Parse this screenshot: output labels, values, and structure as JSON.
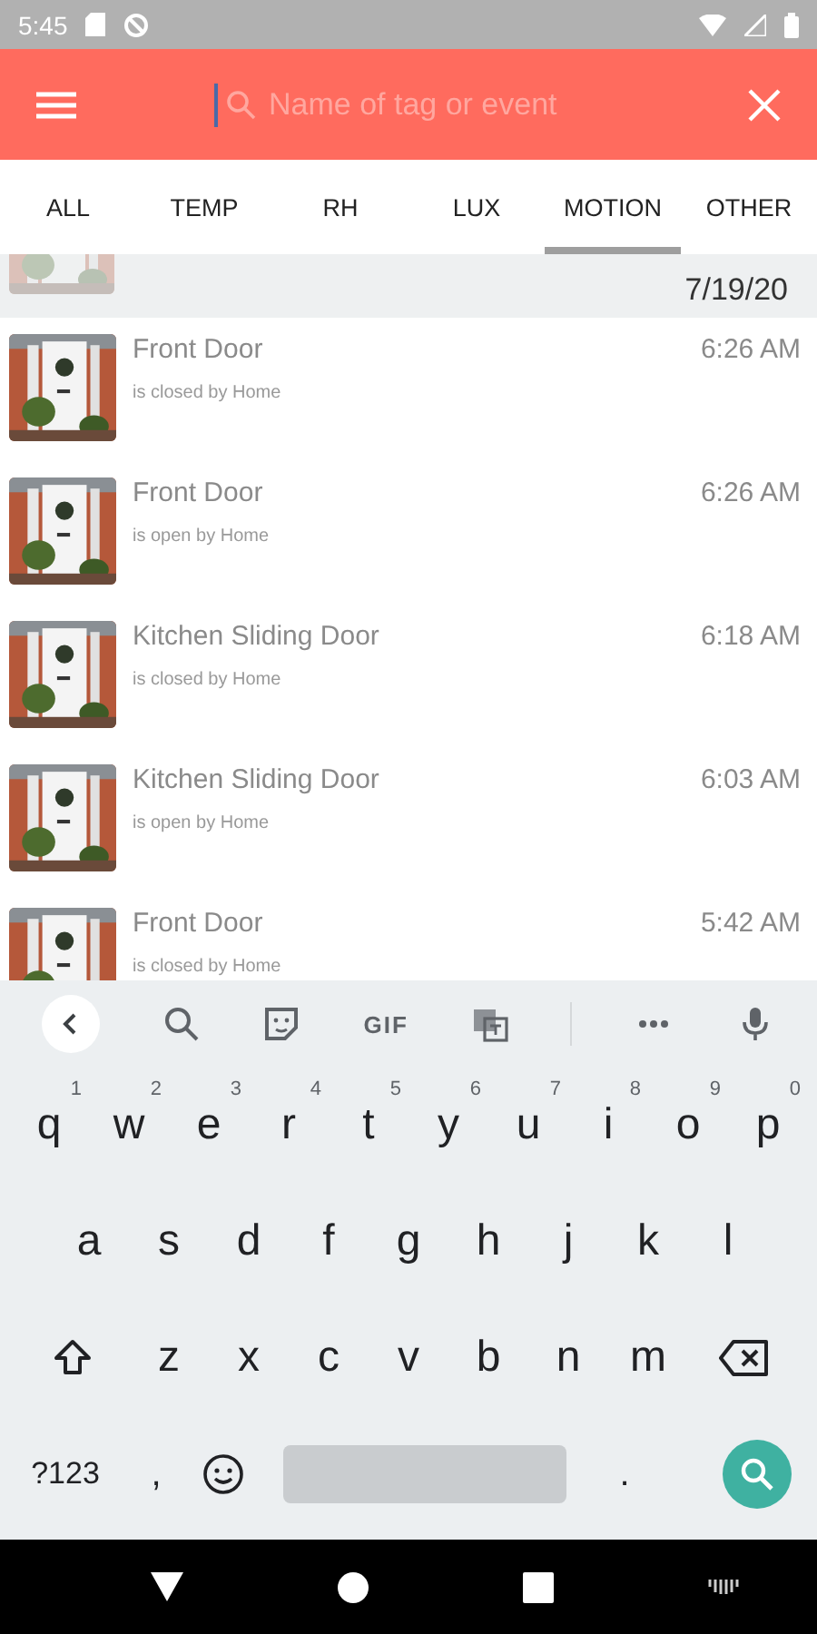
{
  "status_bar": {
    "time": "5:45"
  },
  "app_bar": {
    "search": {
      "placeholder": "Name of tag or event"
    }
  },
  "tabs": [
    {
      "label": "ALL",
      "selected": false
    },
    {
      "label": "TEMP",
      "selected": false
    },
    {
      "label": "RH",
      "selected": false
    },
    {
      "label": "LUX",
      "selected": false
    },
    {
      "label": "MOTION",
      "selected": true
    },
    {
      "label": "OTHER",
      "selected": false
    }
  ],
  "events": {
    "date": "7/19/20",
    "items": [
      {
        "title": "Front Door",
        "detail": "is closed by Home",
        "time": "6:26 AM"
      },
      {
        "title": "Front Door",
        "detail": "is open by Home",
        "time": "6:26 AM"
      },
      {
        "title": "Kitchen Sliding Door",
        "detail": "is closed by Home",
        "time": "6:18 AM"
      },
      {
        "title": "Kitchen Sliding Door",
        "detail": "is open by Home",
        "time": "6:03 AM"
      },
      {
        "title": "Front Door",
        "detail": "is closed by Home",
        "time": "5:42 AM"
      }
    ]
  },
  "keyboard": {
    "toolbar": {
      "gif": "GIF"
    },
    "rows": [
      [
        {
          "label": "q",
          "hint": "1"
        },
        {
          "label": "w",
          "hint": "2"
        },
        {
          "label": "e",
          "hint": "3"
        },
        {
          "label": "r",
          "hint": "4"
        },
        {
          "label": "t",
          "hint": "5"
        },
        {
          "label": "y",
          "hint": "6"
        },
        {
          "label": "u",
          "hint": "7"
        },
        {
          "label": "i",
          "hint": "8"
        },
        {
          "label": "o",
          "hint": "9"
        },
        {
          "label": "p",
          "hint": "0"
        }
      ],
      [
        {
          "label": "a"
        },
        {
          "label": "s"
        },
        {
          "label": "d"
        },
        {
          "label": "f"
        },
        {
          "label": "g"
        },
        {
          "label": "h"
        },
        {
          "label": "j"
        },
        {
          "label": "k"
        },
        {
          "label": "l"
        }
      ],
      [
        {
          "label": "z"
        },
        {
          "label": "x"
        },
        {
          "label": "c"
        },
        {
          "label": "v"
        },
        {
          "label": "b"
        },
        {
          "label": "n"
        },
        {
          "label": "m"
        }
      ]
    ],
    "symbols_key": "?123",
    "comma_key": ",",
    "period_key": "."
  }
}
